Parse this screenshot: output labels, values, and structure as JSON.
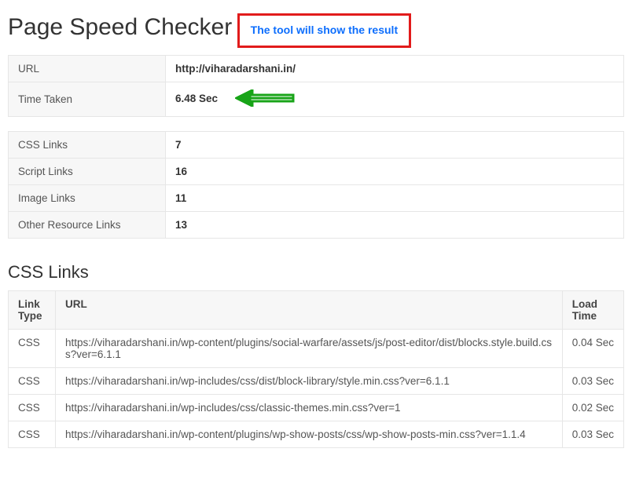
{
  "page": {
    "title": "Page Speed Checker",
    "tip": "The tool will show the result"
  },
  "summary": {
    "url_label": "URL",
    "url_value": "http://viharadarshani.in/",
    "time_label": "Time Taken",
    "time_value": "6.48 Sec"
  },
  "counts": {
    "css_label": "CSS Links",
    "css_value": "7",
    "script_label": "Script Links",
    "script_value": "16",
    "image_label": "Image Links",
    "image_value": "11",
    "other_label": "Other Resource Links",
    "other_value": "13"
  },
  "css_section": {
    "heading": "CSS Links",
    "headers": {
      "link_type": "Link Type",
      "url": "URL",
      "load_time": "Load Time"
    },
    "rows": [
      {
        "type": "CSS",
        "url": "https://viharadarshani.in/wp-content/plugins/social-warfare/assets/js/post-editor/dist/blocks.style.build.css?ver=6.1.1",
        "time": "0.04 Sec"
      },
      {
        "type": "CSS",
        "url": "https://viharadarshani.in/wp-includes/css/dist/block-library/style.min.css?ver=6.1.1",
        "time": "0.03 Sec"
      },
      {
        "type": "CSS",
        "url": "https://viharadarshani.in/wp-includes/css/classic-themes.min.css?ver=1",
        "time": "0.02 Sec"
      },
      {
        "type": "CSS",
        "url": "https://viharadarshani.in/wp-content/plugins/wp-show-posts/css/wp-show-posts-min.css?ver=1.1.4",
        "time": "0.03 Sec"
      }
    ]
  },
  "colors": {
    "tip_border": "#e11b1b",
    "tip_text": "#0d6efd",
    "arrow": "#18a418"
  }
}
